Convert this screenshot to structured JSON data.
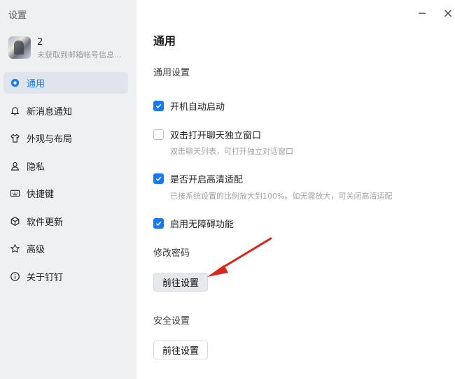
{
  "sidebar": {
    "title": "设置",
    "profile": {
      "name": "2",
      "subtitle": "未获取到邮箱帐号信息..."
    },
    "items": [
      {
        "label": "通用",
        "icon": "general-dot-icon",
        "active": true
      },
      {
        "label": "新消息通知",
        "icon": "bell-icon"
      },
      {
        "label": "外观与布局",
        "icon": "shirt-icon"
      },
      {
        "label": "隐私",
        "icon": "person-icon"
      },
      {
        "label": "快捷键",
        "icon": "keyboard-icon"
      },
      {
        "label": "软件更新",
        "icon": "cube-icon"
      },
      {
        "label": "高级",
        "icon": "star-icon"
      },
      {
        "label": "关于钉钉",
        "icon": "info-icon"
      }
    ]
  },
  "window": {
    "minimize_icon": "minimize-icon",
    "close_icon": "close-icon"
  },
  "main": {
    "title": "通用",
    "general_section": "通用设置",
    "options": [
      {
        "label": "开机自动启动",
        "checked": true,
        "hint": ""
      },
      {
        "label": "双击打开聊天独立窗口",
        "checked": false,
        "hint": "双击聊天列表，可打开独立对话窗口"
      },
      {
        "label": "是否开启高清适配",
        "checked": true,
        "hint": "已按系统设置的比例放大到100%。如无需放大，可关闭高清适配"
      },
      {
        "label": "启用无障碍功能",
        "checked": true,
        "hint": ""
      }
    ],
    "password_section": "修改密码",
    "password_button": "前往设置",
    "security_section": "安全设置",
    "security_button": "前往设置"
  },
  "colors": {
    "accent": "#1677ff",
    "annotation_arrow": "#d9261c",
    "sidebar_bg": "#eff0f2"
  }
}
